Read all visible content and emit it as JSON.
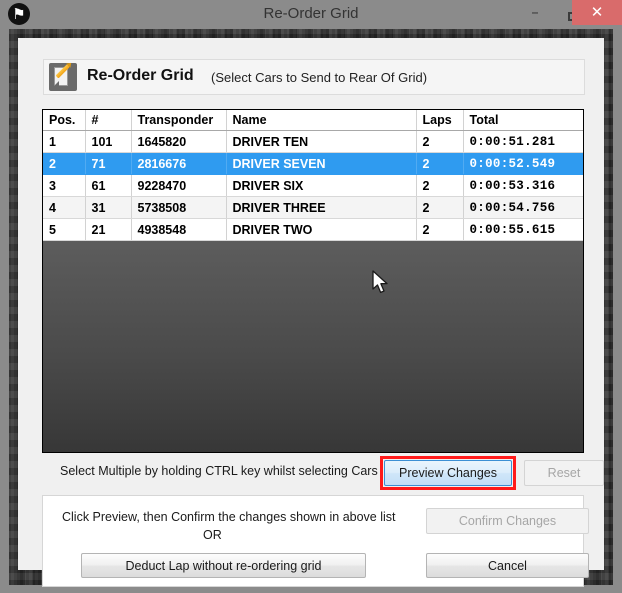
{
  "window": {
    "title": "Re-Order Grid",
    "app_icon": "checkered-flag-icon",
    "controls": {
      "minimize": "–",
      "maximize": "□",
      "close": "✕"
    }
  },
  "header": {
    "icon": "edit-document-icon",
    "title": "Re-Order Grid",
    "subtitle": "(Select Cars to Send to Rear Of Grid)"
  },
  "grid": {
    "columns": [
      "Pos.",
      "#",
      "Transponder",
      "Name",
      "Laps",
      "Total"
    ],
    "rows": [
      {
        "pos": "1",
        "num": "101",
        "transponder": "1645820",
        "name": "DRIVER TEN",
        "laps": "2",
        "total": "0:00:51.281",
        "selected": false
      },
      {
        "pos": "2",
        "num": "71",
        "transponder": "2816676",
        "name": "DRIVER SEVEN",
        "laps": "2",
        "total": "0:00:52.549",
        "selected": true
      },
      {
        "pos": "3",
        "num": "61",
        "transponder": "9228470",
        "name": "DRIVER SIX",
        "laps": "2",
        "total": "0:00:53.316",
        "selected": false
      },
      {
        "pos": "4",
        "num": "31",
        "transponder": "5738508",
        "name": "DRIVER THREE",
        "laps": "2",
        "total": "0:00:54.756",
        "selected": false
      },
      {
        "pos": "5",
        "num": "21",
        "transponder": "4938548",
        "name": "DRIVER TWO",
        "laps": "2",
        "total": "0:00:55.615",
        "selected": false
      }
    ]
  },
  "actions": {
    "hint": "Select Multiple by holding CTRL key whilst selecting Cars",
    "preview_label": "Preview Changes",
    "reset_label": "Reset"
  },
  "panel": {
    "instruction": "Click Preview, then Confirm the changes shown in above list",
    "or_label": "OR",
    "deduct_label": "Deduct Lap without re-ordering grid",
    "confirm_label": "Confirm Changes",
    "cancel_label": "Cancel"
  },
  "colors": {
    "selection_blue": "#2f9bf0",
    "annotation_red": "#ff1a1a",
    "close_button_red": "#d96b6b",
    "frame_dark": "#323232",
    "dialog_bg": "#f0f0f0"
  }
}
